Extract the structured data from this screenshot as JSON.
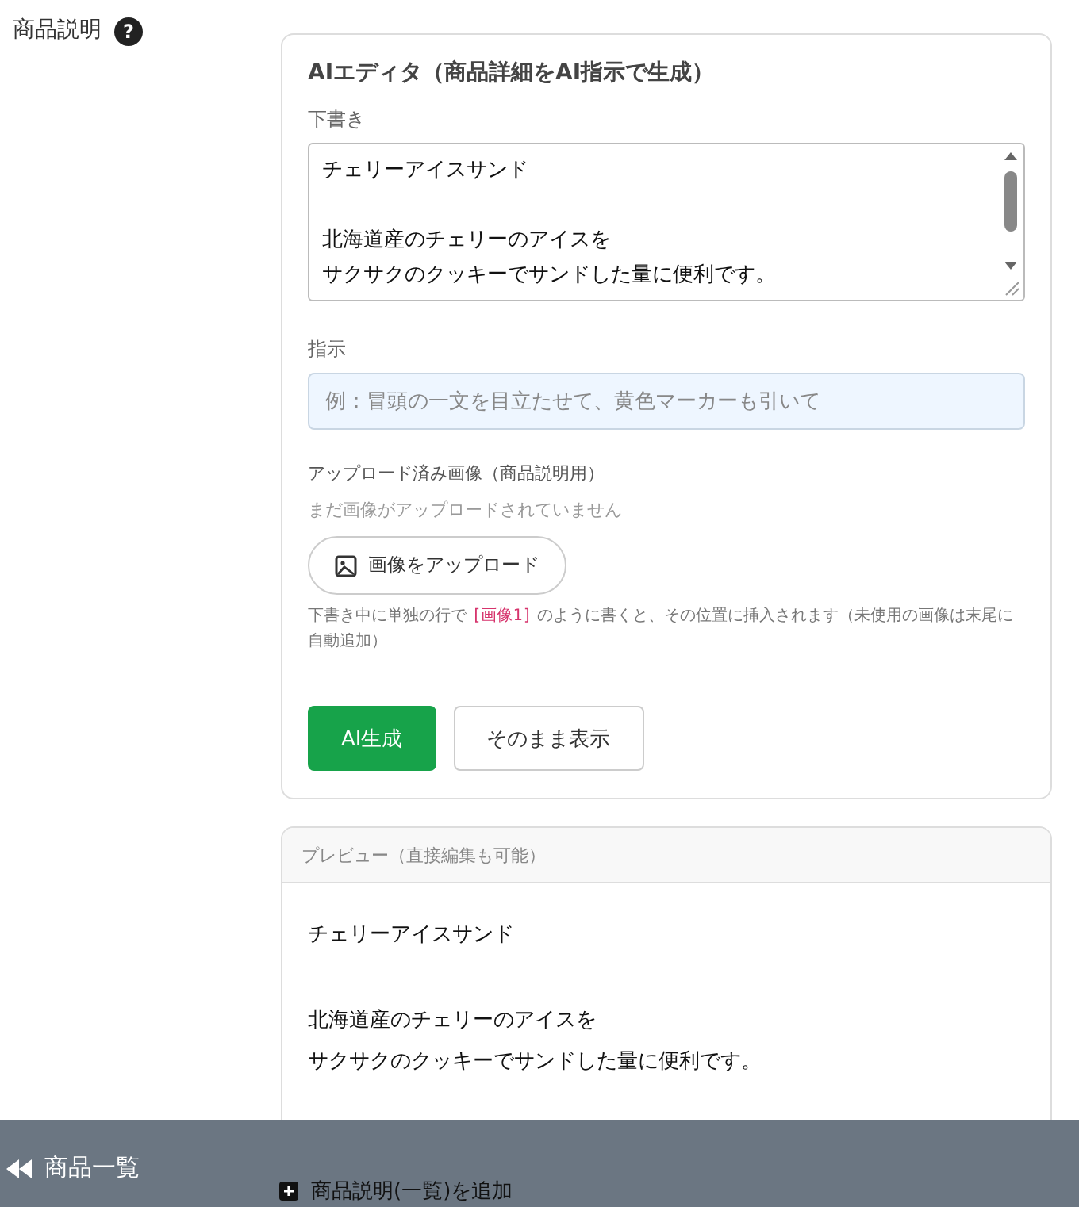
{
  "field": {
    "label": "商品説明",
    "help_mark": "?"
  },
  "editor": {
    "title": "AIエディタ（商品詳細をAI指示で生成）",
    "draft": {
      "label": "下書き",
      "paragraphs": [
        {
          "lines": [
            "チェリーアイスサンド"
          ]
        },
        {
          "lines": [
            "北海道産のチェリーのアイスを",
            "サクサクのクッキーでサンドした量に便利です。"
          ]
        }
      ]
    },
    "instruction": {
      "label": "指示",
      "placeholder": "例：冒頭の一文を目立たせて、黄色マーカーも引いて"
    },
    "uploads": {
      "label": "アップロード済み画像（商品説明用）",
      "empty_message": "まだ画像がアップロードされていません",
      "upload_button": "画像をアップロード",
      "hint": [
        {
          "kind": "text",
          "text": "下書き中に単独の行で "
        },
        {
          "kind": "tag",
          "text": "[画像1]"
        },
        {
          "kind": "text",
          "text": " のように書くと、その位置に挿入されます（未使用の画像は末尾に自動追加）"
        }
      ]
    },
    "buttons": [
      {
        "label": "AI生成",
        "kind": "primary"
      },
      {
        "label": "そのまま表示",
        "kind": "secondary"
      }
    ]
  },
  "preview": {
    "header": "プレビュー（直接編集も可能）",
    "paragraphs": [
      {
        "lines": [
          "チェリーアイスサンド"
        ]
      },
      {
        "lines": [
          "北海道産のチェリーのアイスを",
          "サクサクのクッキーでサンドした量に便利です。"
        ]
      }
    ]
  },
  "add_link": "商品説明(一覧)を追加",
  "bottom_bar": {
    "back_link": "商品一覧"
  }
}
